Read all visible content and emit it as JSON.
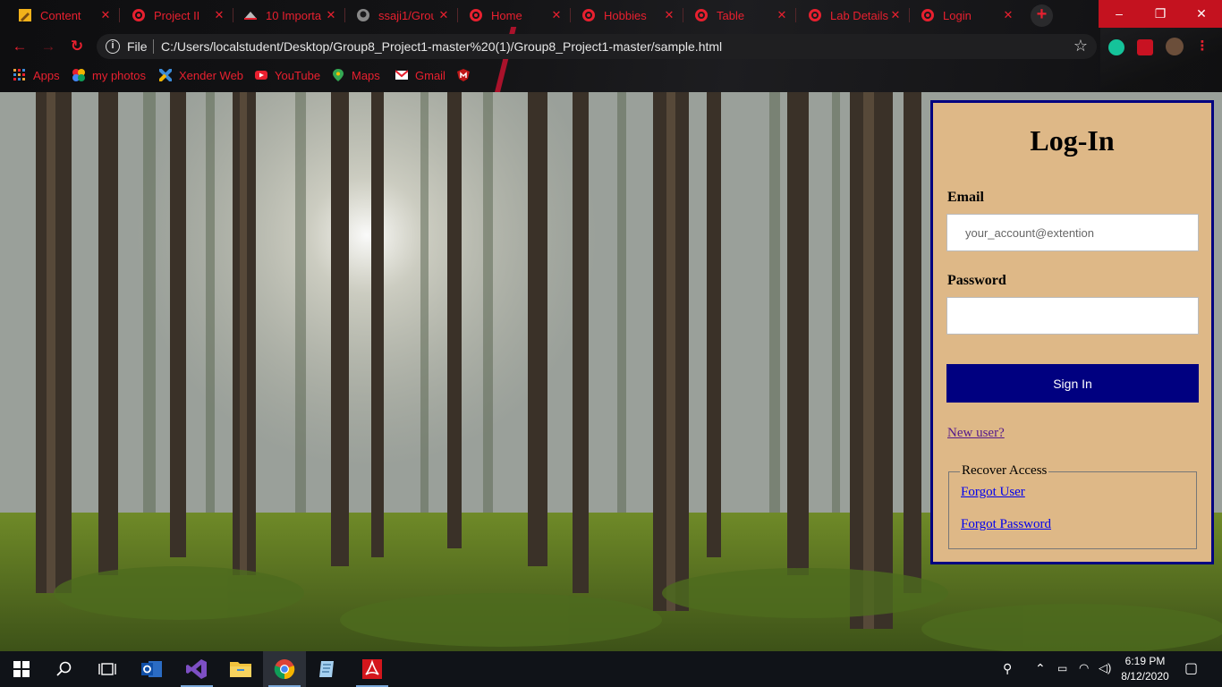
{
  "browser": {
    "tabs": [
      {
        "title": "Content",
        "favicon": "pencil-icon"
      },
      {
        "title": "Project II",
        "favicon": "chrome-icon"
      },
      {
        "title": "10 Importa",
        "favicon": "hat-icon"
      },
      {
        "title": "ssaji1/Grou",
        "favicon": "github-icon"
      },
      {
        "title": "Home",
        "favicon": "chrome-icon"
      },
      {
        "title": "Hobbies",
        "favicon": "chrome-icon"
      },
      {
        "title": "Table",
        "favicon": "chrome-icon"
      },
      {
        "title": "Lab Details",
        "favicon": "chrome-icon"
      },
      {
        "title": "Login",
        "favicon": "chrome-icon"
      }
    ],
    "new_tab": "+",
    "window_controls": {
      "minimize": "–",
      "restore": "❐",
      "close": "✕"
    },
    "address": {
      "scheme_label": "File",
      "url": "C:/Users/localstudent/Desktop/Group8_Project1-master%20(1)/Group8_Project1-master/sample.html"
    },
    "bookmarks": [
      {
        "label": "Apps",
        "icon": "apps-grid-icon"
      },
      {
        "label": "my photos",
        "icon": "photos-icon"
      },
      {
        "label": "Xender Web",
        "icon": "xender-icon"
      },
      {
        "label": "YouTube",
        "icon": "youtube-icon"
      },
      {
        "label": "Maps",
        "icon": "maps-icon"
      },
      {
        "label": "Gmail",
        "icon": "gmail-icon"
      },
      {
        "label": "",
        "icon": "mcafee-icon"
      }
    ],
    "accent_color": "#e8202f"
  },
  "login": {
    "title": "Log-In",
    "email_label": "Email",
    "email_placeholder": "your_account@extention",
    "email_value": "",
    "password_label": "Password",
    "password_value": "",
    "signin_label": "Sign In",
    "new_user_label": "New user?",
    "recover_legend": "Recover Access",
    "forgot_user": "Forgot User",
    "forgot_password": "Forgot Password",
    "panel_color": "#deb887",
    "border_color": "#000080"
  },
  "taskbar": {
    "apps": [
      "windows-start-icon",
      "search-icon",
      "task-view-icon",
      "outlook-icon",
      "visual-studio-icon",
      "file-explorer-icon",
      "chrome-icon",
      "notepad-icon",
      "acrobat-icon"
    ],
    "time": "6:19 PM",
    "date": "8/12/2020"
  }
}
